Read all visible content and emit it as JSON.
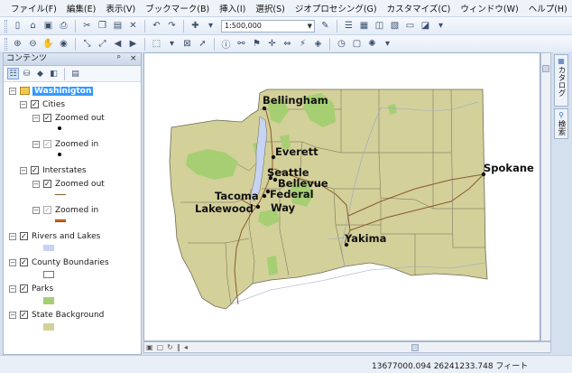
{
  "menubar": {
    "items": [
      "ファイル(F)",
      "編集(E)",
      "表示(V)",
      "ブックマーク(B)",
      "挿入(I)",
      "選択(S)",
      "ジオプロセシング(G)",
      "カスタマイズ(C)",
      "ウィンドウ(W)",
      "ヘルプ(H)"
    ]
  },
  "toolbar": {
    "scale": "1:500,000"
  },
  "toc": {
    "title": "コンテンツ",
    "pin": "ᵖ",
    "close": "×",
    "data_frame": "Washinigton",
    "layers": {
      "cities": "Cities",
      "cities_zoomed_out": "Zoomed out",
      "cities_zoomed_in": "Zoomed in",
      "interstates": "Interstates",
      "interstates_zoomed_out": "Zoomed out",
      "interstates_zoomed_in": "Zoomed in",
      "rivers": "Rivers and Lakes",
      "counties": "County Boundaries",
      "parks": "Parks",
      "state_bg": "State Background"
    }
  },
  "map": {
    "cities": {
      "bellingham": "Bellingham",
      "everett": "Everett",
      "seattle": "Seattle",
      "bellevue": "Bellevue",
      "tacoma": "Tacoma",
      "federal": "Federal",
      "lakewood": "Lakewood",
      "way": "Way",
      "yakima": "Yakima",
      "spokane": "Spokane"
    },
    "colors": {
      "state": "#d3d09a",
      "parks": "#a6cf73",
      "counties": "#6f6a55",
      "interstates": "#8b5a2b",
      "water": "#c6d3f2"
    }
  },
  "dock": {
    "catalog": "カタログ",
    "search": "検索"
  },
  "status": {
    "coords": "13677000.094  26241233.748 フィート"
  }
}
